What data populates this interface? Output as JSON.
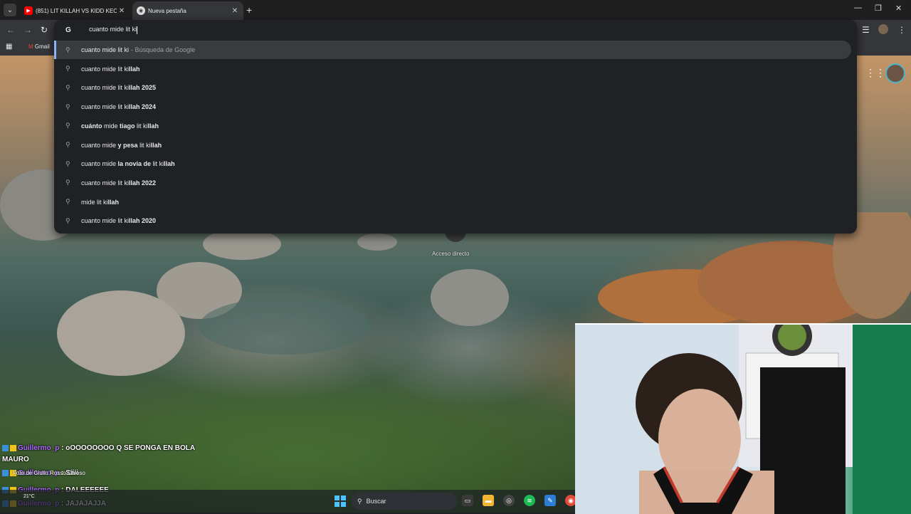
{
  "tabs": [
    {
      "title": "(851) LIT KILLAH VS KIDD KEO |",
      "icon": "youtube-icon",
      "active": false
    },
    {
      "title": "Nueva pestaña",
      "icon": "chrome-icon",
      "active": true
    }
  ],
  "bookmarks": {
    "gmail": "Gmail"
  },
  "omnibox": {
    "typed": "cuanto mide lit ki",
    "suggestions": [
      {
        "pre": "cuanto mide lit ki",
        "bold": "",
        "post": "",
        "hint": "- Búsqueda de Google",
        "selected": true
      },
      {
        "pre": "cuanto mide lit ki",
        "bold": "llah",
        "post": "",
        "hint": ""
      },
      {
        "pre": "cuanto mide lit ki",
        "bold": "llah 2025",
        "post": "",
        "hint": ""
      },
      {
        "pre": "cuanto mide lit ki",
        "bold": "llah 2024",
        "post": "",
        "hint": ""
      },
      {
        "pre": "",
        "bold": "cuánto",
        "mid": " mide ",
        "bold2": "tiago",
        "post": " lit ki",
        "bold3": "llah"
      },
      {
        "pre": "cuanto mide ",
        "bold": "y pesa",
        "post": " lit ki",
        "bold3": "llah"
      },
      {
        "pre": "cuanto mide ",
        "bold": "la novia de",
        "post": " lit ki",
        "bold3": "llah"
      },
      {
        "pre": "cuanto mide lit ki",
        "bold": "llah 2022",
        "post": "",
        "hint": ""
      },
      {
        "pre": "mide lit ki",
        "bold": "llah",
        "post": "",
        "hint": ""
      },
      {
        "pre": "cuanto mide lit ki",
        "bold": "llah 2020",
        "post": "",
        "hint": ""
      }
    ]
  },
  "ntp": {
    "shortcut_label": "Acceso directo"
  },
  "chat": [
    {
      "user": "Guillermo_p",
      "message": "oOOOOOOOO Q SE PONGA EN BOLA"
    },
    {
      "user": "",
      "message": "MAURO"
    },
    {
      "user": "Guillermo_p",
      "message": "Siiii"
    },
    {
      "user": "Guillermo_p",
      "message": "DALEEEEEE"
    },
    {
      "user": "Guillermo_p",
      "message": "JAJAJAJJA"
    }
  ],
  "photo_credit": "Foto de Giulio Rosso Chioso",
  "taskbar": {
    "search_label": "Buscar",
    "weather": "21°C"
  },
  "colors": {
    "accent": "#8ab4f8",
    "chat_user": "#b06cff"
  }
}
